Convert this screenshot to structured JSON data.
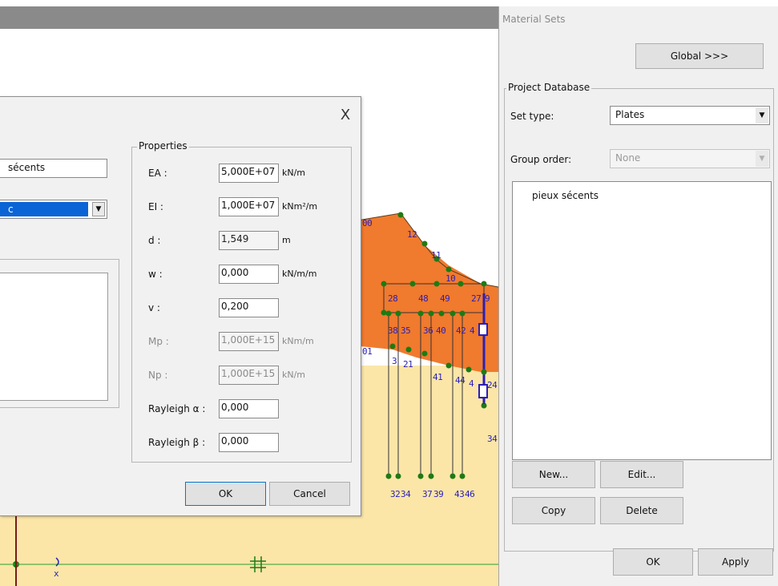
{
  "canvas": {
    "labels": [
      "00",
      "12",
      "11",
      "10",
      "28",
      "48",
      "49",
      "27",
      "9",
      "38",
      "35",
      "36",
      "40",
      "42",
      "4",
      "01",
      "3",
      "21",
      "41",
      "44",
      "4",
      "24",
      "1",
      "34",
      "32",
      "34",
      "37",
      "39",
      "43",
      "46"
    ],
    "axis_label": "x"
  },
  "plate_dialog": {
    "close_symbol": "X",
    "name_value": "sécents",
    "type_value": "c",
    "properties_title": "Properties",
    "properties": [
      {
        "label": "EA :",
        "value": "5,000E+07",
        "unit": "kN/m",
        "enabled": true
      },
      {
        "label": "EI :",
        "value": "1,000E+07",
        "unit": "kNm²/m",
        "enabled": true
      },
      {
        "label": "d :",
        "value": "1,549",
        "unit": "m",
        "enabled": false
      },
      {
        "label": "w :",
        "value": "0,000",
        "unit": "kN/m/m",
        "enabled": true
      },
      {
        "label": "v :",
        "value": "0,200",
        "unit": "",
        "enabled": true
      },
      {
        "label": "Mp :",
        "value": "1,000E+15",
        "unit": "kNm/m",
        "enabled": false
      },
      {
        "label": "Np :",
        "value": "1,000E+15",
        "unit": "kN/m",
        "enabled": false
      },
      {
        "label": "Rayleigh α :",
        "value": "0,000",
        "unit": "",
        "enabled": true
      },
      {
        "label": "Rayleigh β :",
        "value": "0,000",
        "unit": "",
        "enabled": true
      }
    ],
    "ok_label": "OK",
    "cancel_label": "Cancel"
  },
  "material_sets": {
    "title": "Material Sets",
    "global_button": "Global >>>",
    "project_database_label": "Project Database",
    "set_type_label": "Set type:",
    "set_type_value": "Plates",
    "group_order_label": "Group order:",
    "group_order_value": "None",
    "items": [
      "pieux sécents"
    ],
    "new_button": "New...",
    "edit_button": "Edit...",
    "copy_button": "Copy",
    "delete_button": "Delete",
    "ok_button": "OK",
    "apply_button": "Apply"
  },
  "colors": {
    "clay": "#f07a2e",
    "sand": "#fbe6a8",
    "node": "#1f7a14",
    "label": "#2a1fb8",
    "selection": "#0a64d6"
  }
}
